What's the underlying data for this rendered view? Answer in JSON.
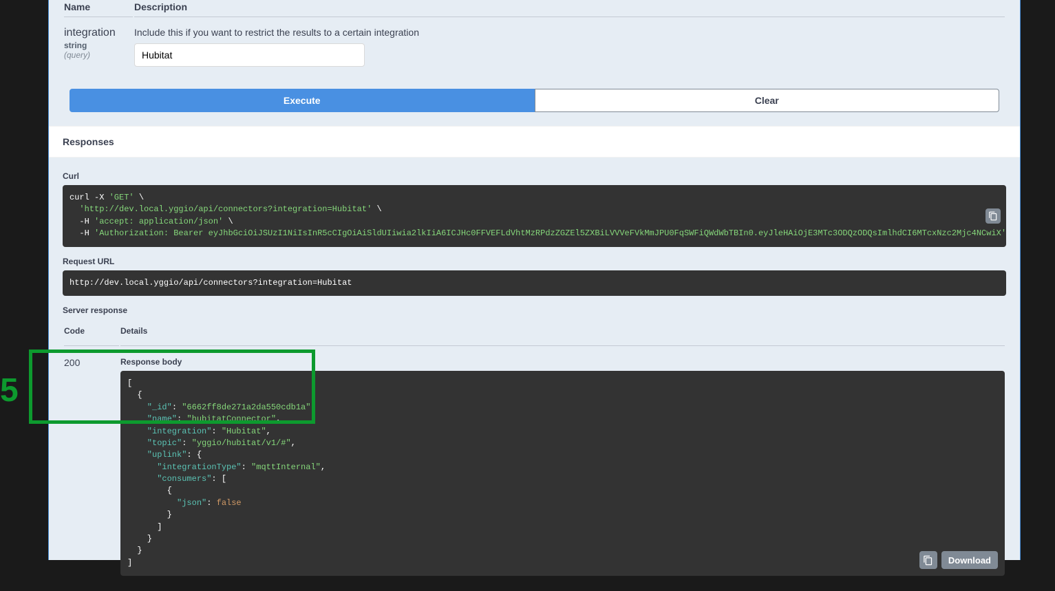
{
  "annotation_number": "5",
  "params": {
    "header_name": "Name",
    "header_desc": "Description",
    "row": {
      "name": "integration",
      "type": "string",
      "in": "(query)",
      "description": "Include this if you want to restrict the results to a certain integration",
      "value": "Hubitat"
    }
  },
  "buttons": {
    "execute": "Execute",
    "clear": "Clear"
  },
  "responses": {
    "heading": "Responses",
    "curl": {
      "title": "Curl",
      "l1a": "curl -X ",
      "l1b": "'GET'",
      "l1c": " \\",
      "l2a": "  'http://dev.local.yggio/api/connectors?integration=Hubitat'",
      "l2b": " \\",
      "l3a": "  -H ",
      "l3b": "'accept: application/json'",
      "l3c": " \\",
      "l4a": "  -H ",
      "l4b": "'Authorization: Bearer eyJhbGciOiJSUzI1NiIsInR5cCIgOiAiSldUIiwia2lkIiA6ICJHc0FFVEFLdVhtMzRPdzZGZEl5ZXBiLVVVeFVkMmJPU0FqSWFiQWdWbTBIn0.eyJleHAiOjE3MTc3ODQzODQsImlhdCI6MTcxNzc2Mjc4NCwiX'"
    },
    "request_url": {
      "title": "Request URL",
      "value": "http://dev.local.yggio/api/connectors?integration=Hubitat"
    },
    "server_response": {
      "title": "Server response",
      "col_code": "Code",
      "col_details": "Details",
      "code": "200",
      "body_title": "Response body",
      "json": {
        "l01": "[",
        "l02": "  {",
        "l03a": "    \"_id\"",
        "l03b": ": ",
        "l03c": "\"6662ff8de271a2da550cdb1a\"",
        "l03d": ",",
        "l04a": "    \"name\"",
        "l04b": ": ",
        "l04c": "\"hubitatConnector\"",
        "l04d": ",",
        "l05a": "    \"integration\"",
        "l05b": ": ",
        "l05c": "\"Hubitat\"",
        "l05d": ",",
        "l06a": "    \"topic\"",
        "l06b": ": ",
        "l06c": "\"yggio/hubitat/v1/#\"",
        "l06d": ",",
        "l07a": "    \"uplink\"",
        "l07b": ": {",
        "l08a": "      \"integrationType\"",
        "l08b": ": ",
        "l08c": "\"mqttInternal\"",
        "l08d": ",",
        "l09a": "      \"consumers\"",
        "l09b": ": [",
        "l10": "        {",
        "l11a": "          \"json\"",
        "l11b": ": ",
        "l11c": "false",
        "l12": "        }",
        "l13": "      ]",
        "l14": "    }",
        "l15": "  }",
        "l16": "]"
      }
    },
    "download": "Download"
  }
}
